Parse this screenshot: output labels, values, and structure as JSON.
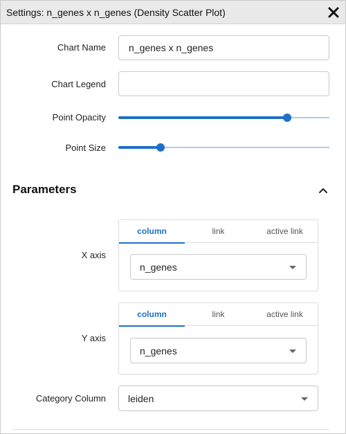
{
  "dialog": {
    "title": "Settings: n_genes x n_genes (Density Scatter Plot)"
  },
  "form": {
    "chart_name_label": "Chart Name",
    "chart_name_value": "n_genes x n_genes",
    "chart_legend_label": "Chart Legend",
    "chart_legend_value": "",
    "point_opacity_label": "Point Opacity",
    "point_opacity_value": 0.8,
    "point_size_label": "Point Size",
    "point_size_value": 0.2
  },
  "parameters": {
    "title": "Parameters",
    "tabs": [
      "column",
      "link",
      "active link"
    ],
    "x_axis": {
      "label": "X axis",
      "active_tab": "column",
      "selected": "n_genes"
    },
    "y_axis": {
      "label": "Y axis",
      "active_tab": "column",
      "selected": "n_genes"
    },
    "category_column": {
      "label": "Category Column",
      "selected": "leiden"
    }
  },
  "colors": {
    "accent": "#1f6fc8",
    "track": "#a9cdef",
    "titlebar": "#e9e9e9"
  },
  "icons": {
    "close": "close-icon",
    "collapse": "chevron-up-icon",
    "dropdown": "caret-down-icon"
  }
}
